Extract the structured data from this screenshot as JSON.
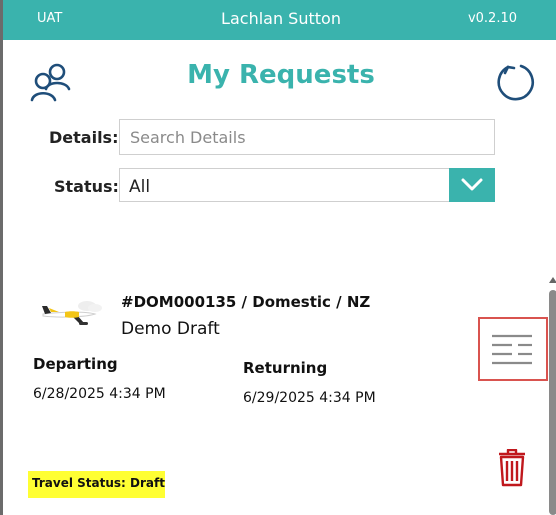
{
  "header": {
    "environment": "UAT",
    "user_name": "Lachlan Sutton",
    "version": "v0.2.10"
  },
  "page": {
    "title": "My Requests"
  },
  "filters": {
    "details_label": "Details:",
    "details_placeholder": "Search Details",
    "details_value": "",
    "status_label": "Status:",
    "status_value": "All"
  },
  "request": {
    "id_line": "#DOM000135 / Domestic / NZ",
    "name": "Demo Draft",
    "departing_label": "Departing",
    "departing_value": "6/28/2025 4:34 PM",
    "returning_label": "Returning",
    "returning_value": "6/29/2025 4:34 PM",
    "travel_status": "Travel Status: Draft"
  },
  "icons": {
    "users": "users-icon",
    "refresh": "refresh-icon",
    "plane": "airplane-icon",
    "menu": "list-menu-icon",
    "delete": "trash-icon",
    "dropdown": "chevron-down-icon"
  },
  "colors": {
    "accent": "#3ab3ad",
    "menu_border": "#d9534f",
    "delete": "#c0181d",
    "status_highlight": "#ffff33"
  }
}
